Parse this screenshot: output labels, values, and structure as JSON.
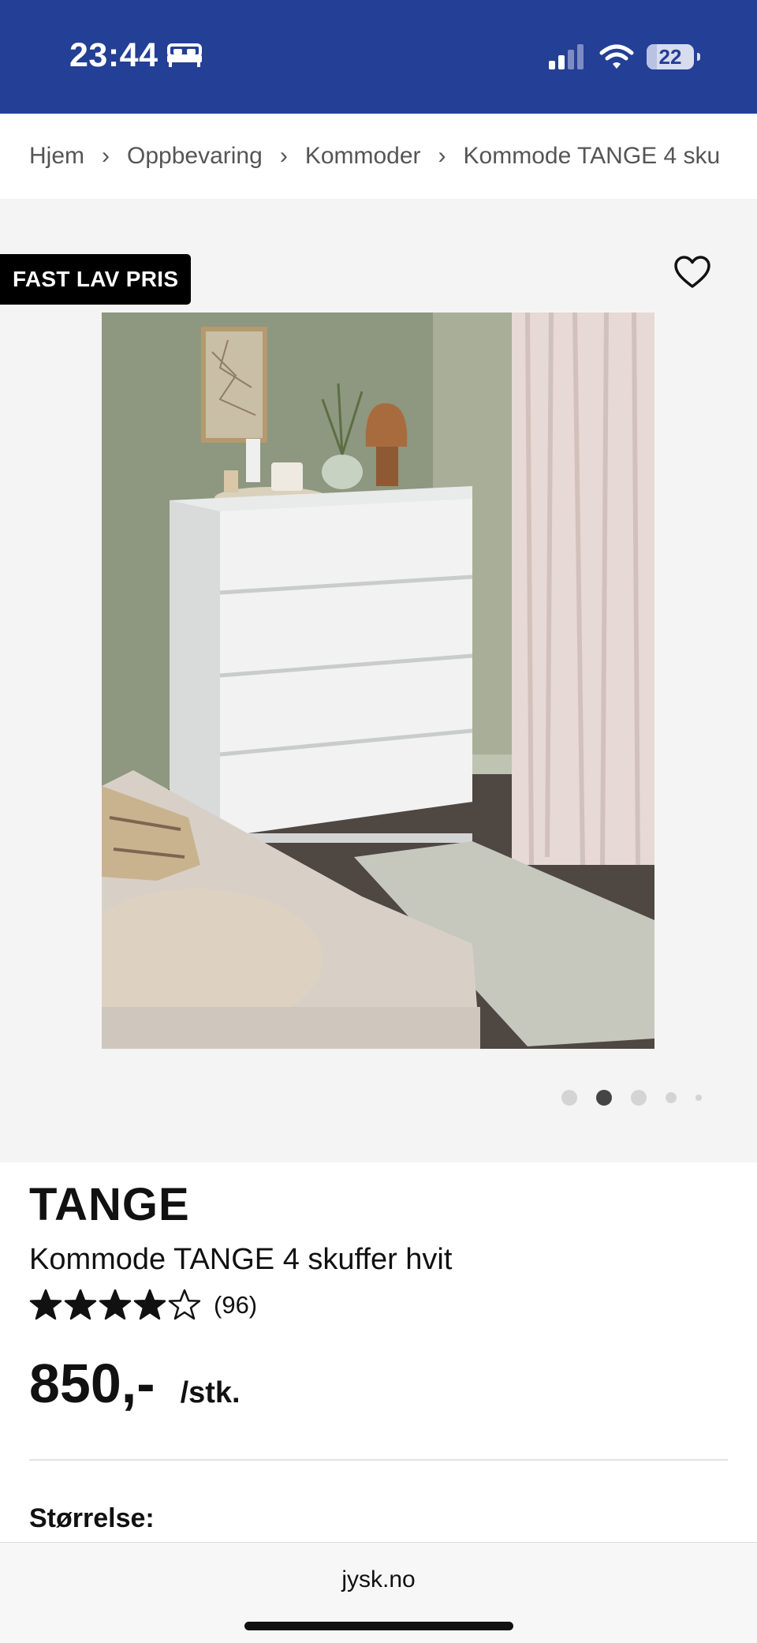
{
  "status_bar": {
    "time": "23:44",
    "battery_level": "22",
    "icons": [
      "bed-icon",
      "signal-icon",
      "wifi-icon",
      "battery-icon"
    ]
  },
  "breadcrumb": {
    "items": [
      "Hjem",
      "Oppbevaring",
      "Kommoder",
      "Kommode TANGE 4 sku"
    ],
    "separator": "›"
  },
  "gallery": {
    "badge": "FAST LAV PRIS",
    "wishlist_icon": "heart-outline-icon",
    "image_alt_icon": "product-photo",
    "slides_total": 5,
    "active_slide": 2
  },
  "product": {
    "brand": "TANGE",
    "name": "Kommode TANGE 4 skuffer hvit",
    "rating": 4,
    "rating_max": 5,
    "review_count": "(96)",
    "price": "850,-",
    "unit": "/stk.",
    "size_label": "Størrelse:"
  },
  "browser": {
    "url": "jysk.no"
  },
  "colors": {
    "status_bar": "#233f96",
    "gallery_bg": "#f4f4f4",
    "badge_bg": "#000000",
    "text": "#111111"
  }
}
